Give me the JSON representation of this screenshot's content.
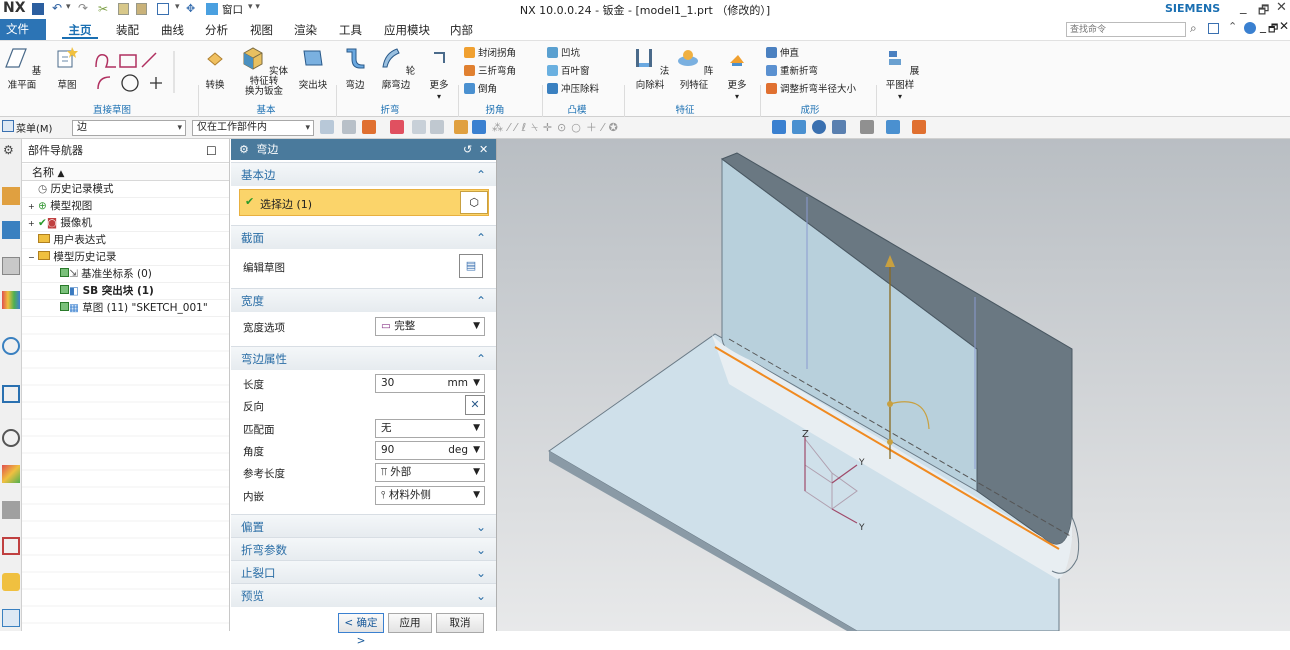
{
  "title": {
    "logo": "NX",
    "window": "NX 10.0.0.24 - 钣金 - [model1_1.prt （修改的）]",
    "window_menu": "窗口",
    "brand": "SIEMENS"
  },
  "menu": {
    "tabs": [
      "文件(F)",
      "主页",
      "装配",
      "曲线",
      "分析",
      "视图",
      "渲染",
      "工具",
      "应用模块",
      "内部"
    ],
    "search_placeholder": "查找命令"
  },
  "ribbon": {
    "buttons": {
      "datum_plane": "基准平面",
      "sketch": "草图",
      "convert": "转换",
      "solid_to_sheet": "实体特征转",
      "solid_to_sheet2": "换为钣金",
      "tab": "突出块",
      "flange": "弯边",
      "contour_flange": "轮廓弯边",
      "more1": "更多",
      "normal_cutout": "法向除料",
      "pattern": "阵列特征",
      "more2": "更多",
      "unbend": "展平图样"
    },
    "small": {
      "closed_corner": "封闭拐角",
      "three_bend": "三折弯角",
      "chamfer": "倒角",
      "dimple": "凹坑",
      "louver": "百叶窗",
      "drawn_cutout": "冲压除料",
      "bend": "伸直",
      "rebend": "重新折弯",
      "resize_bend": "调整折弯半径大小"
    },
    "groups": {
      "direct_sketch": "直接草图",
      "basic": "基本",
      "bend": "折弯",
      "corner": "拐角",
      "convex": "凸模",
      "feature": "特征",
      "form": "成形"
    }
  },
  "selbar": {
    "menu": "菜单(M)",
    "filter": "边",
    "scope": "仅在工作部件内"
  },
  "navigator": {
    "title": "部件导航器",
    "col_name": "名称",
    "rows": [
      "历史记录模式",
      "模型视图",
      "摄像机",
      "用户表达式",
      "模型历史记录",
      "基准坐标系 (0)",
      "SB 突出块 (1)",
      "草图 (11) \"SKETCH_001\""
    ]
  },
  "dialog": {
    "title": "弯边",
    "sections": {
      "base_edge": "基本边",
      "section": "截面",
      "width": "宽度",
      "props": "弯边属性",
      "offset": "偏置",
      "bend_params": "折弯参数",
      "relief": "止裂口",
      "preview": "预览"
    },
    "select_edge": "选择边 (1)",
    "edit_sketch": "编辑草图",
    "width_option_label": "宽度选项",
    "width_option": "完整",
    "length_label": "长度",
    "length": "30",
    "length_unit": "mm",
    "reverse_label": "反向",
    "match_label": "匹配面",
    "match": "无",
    "angle_label": "角度",
    "angle": "90",
    "angle_unit": "deg",
    "ref_length_label": "参考长度",
    "ref_length": "外部",
    "inset_label": "内嵌",
    "inset": "材料外侧",
    "ok": "< 确定 >",
    "apply": "应用",
    "cancel": "取消"
  },
  "viewport": {
    "axis_z": "Z",
    "axis_y": "Y"
  }
}
